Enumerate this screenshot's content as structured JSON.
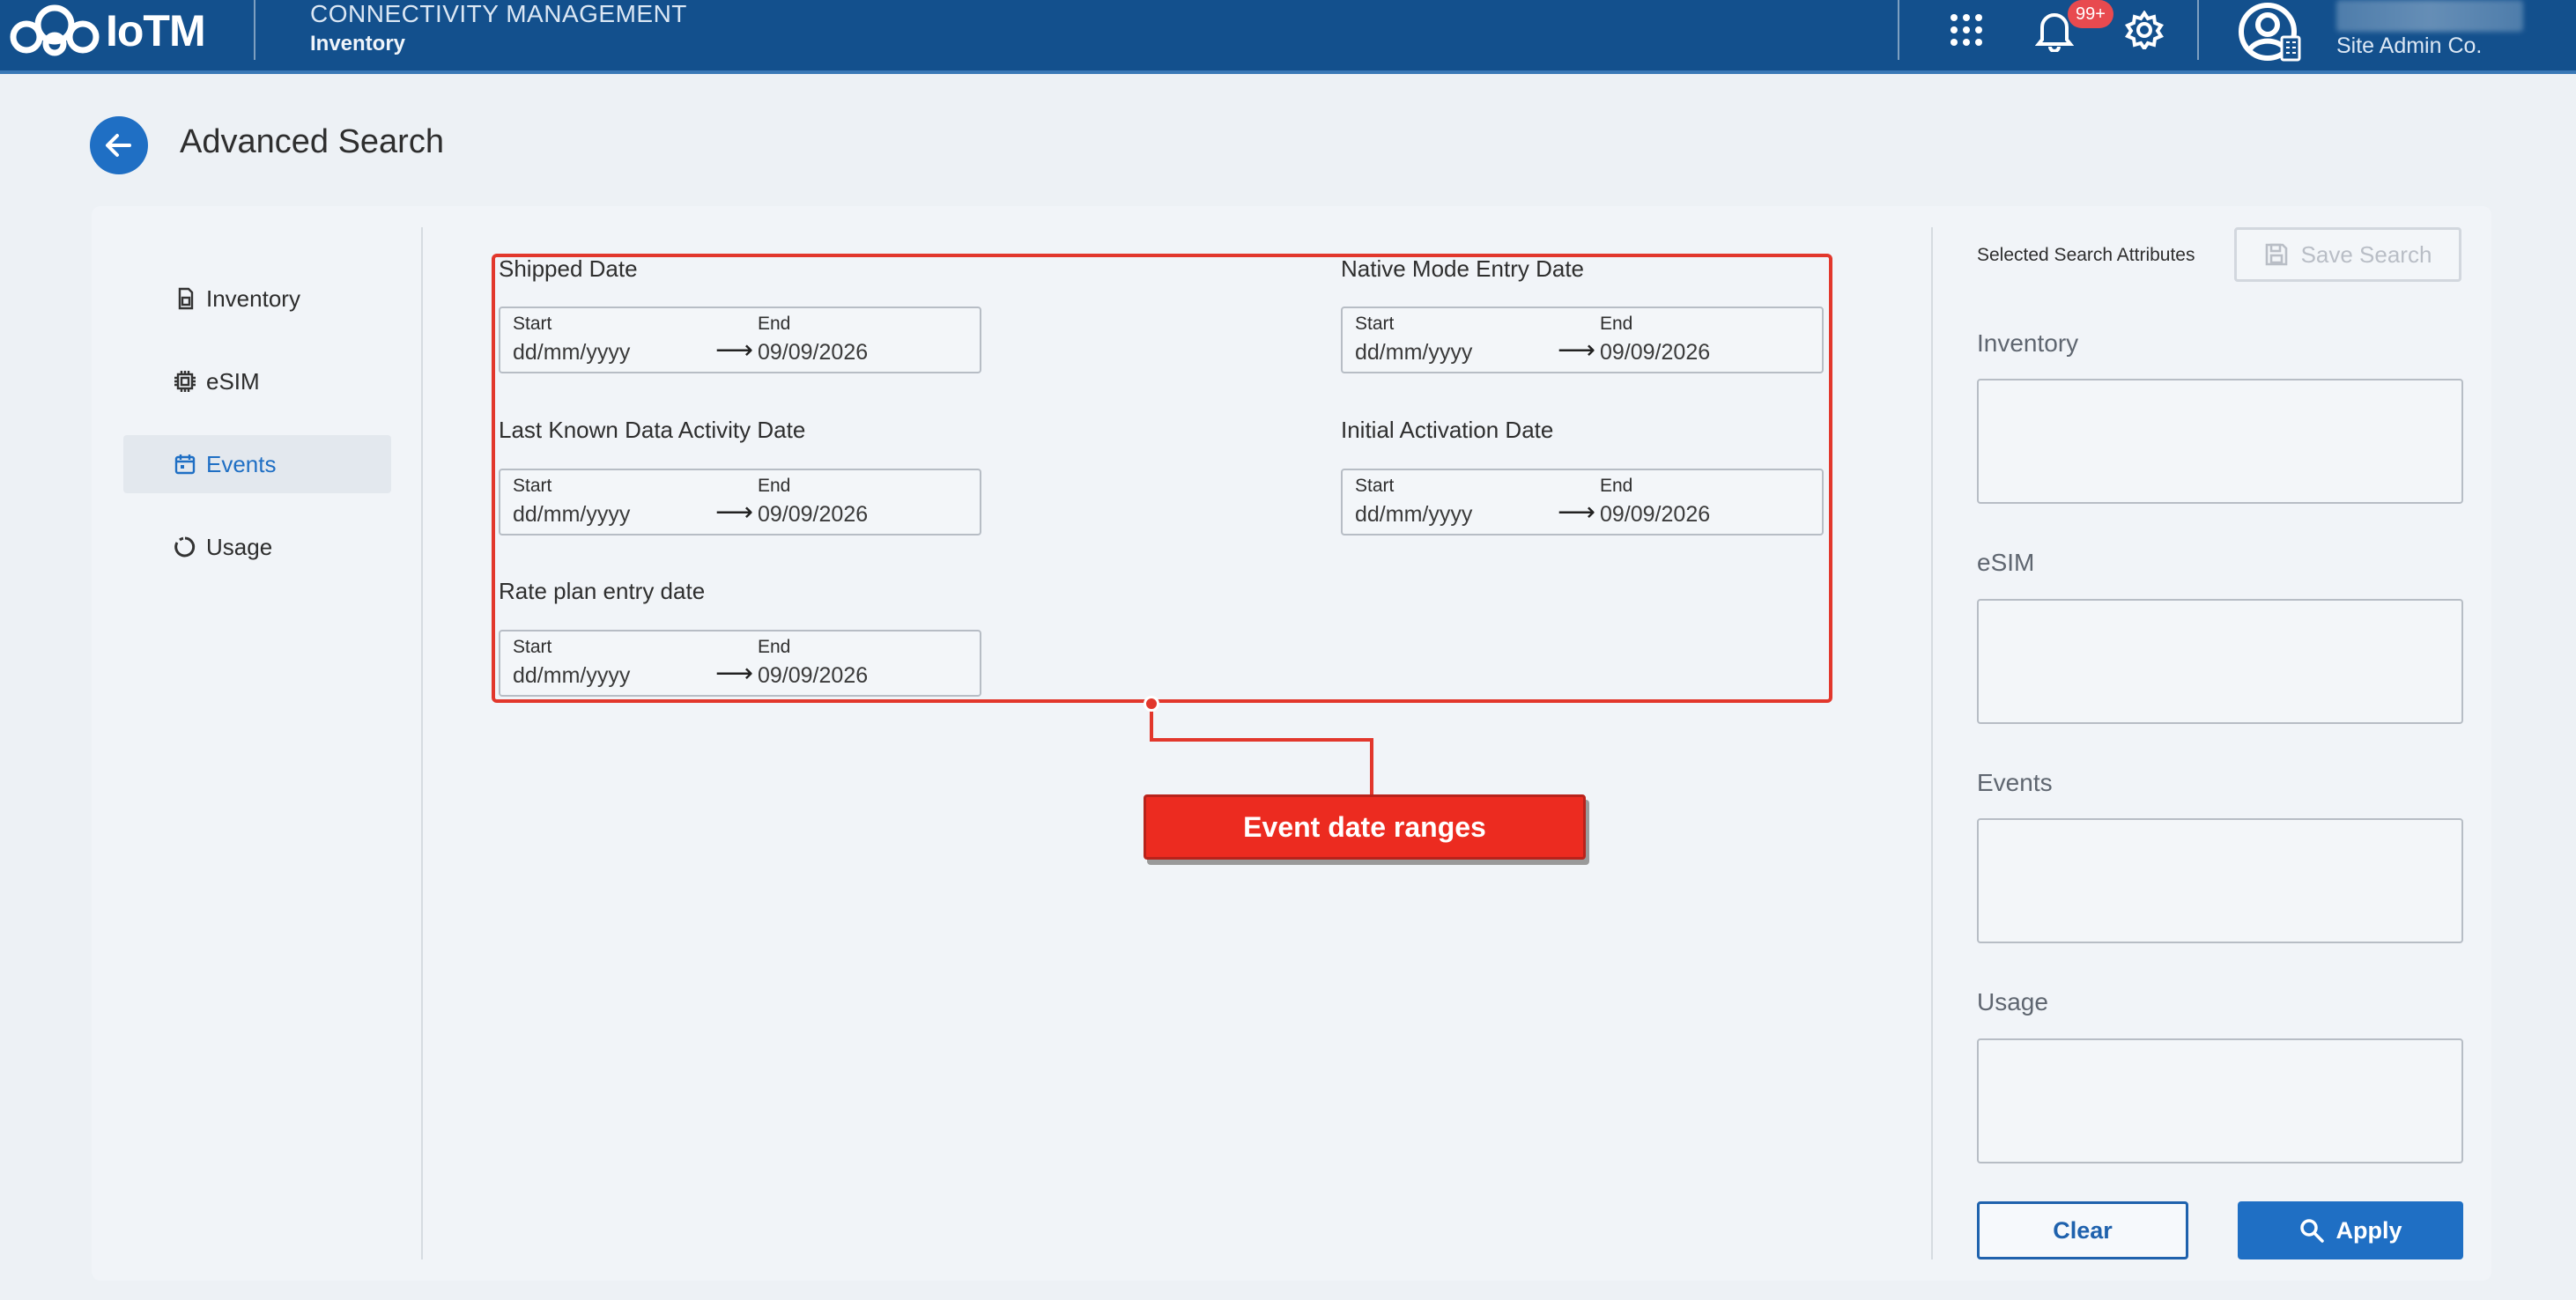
{
  "header": {
    "logo_text": "IoTM",
    "app_title": "CONNECTIVITY MANAGEMENT",
    "app_subtitle": "Inventory",
    "notification_count": "99+",
    "company": "Site Admin Co.",
    "colors": {
      "bar": "#13508d",
      "badge": "#e84a4f"
    }
  },
  "page": {
    "title": "Advanced Search"
  },
  "sidebar": {
    "items": [
      {
        "label": "Inventory",
        "icon": "sim-card-icon",
        "active": false
      },
      {
        "label": "eSIM",
        "icon": "chip-icon",
        "active": false
      },
      {
        "label": "Events",
        "icon": "calendar-icon",
        "active": true
      },
      {
        "label": "Usage",
        "icon": "donut-chart-icon",
        "active": false
      }
    ]
  },
  "date_fields": {
    "start_caption": "Start",
    "end_caption": "End",
    "start_placeholder": "dd/mm/yyyy",
    "arrow": "⟶",
    "items": [
      {
        "label": "Shipped Date",
        "end_value": "09/09/2026"
      },
      {
        "label": "Native Mode Entry Date",
        "end_value": "09/09/2026"
      },
      {
        "label": "Last Known Data Activity Date",
        "end_value": "09/09/2026"
      },
      {
        "label": "Initial Activation Date",
        "end_value": "09/09/2026"
      },
      {
        "label": "Rate plan entry date",
        "end_value": "09/09/2026"
      }
    ]
  },
  "annotation": {
    "label": "Event date ranges",
    "color": "#e2372c"
  },
  "right_panel": {
    "title": "Selected Search Attributes",
    "save_label": "Save Search",
    "sections": [
      "Inventory",
      "eSIM",
      "Events",
      "Usage"
    ],
    "clear_label": "Clear",
    "apply_label": "Apply",
    "accent": "#1f6fc4"
  }
}
